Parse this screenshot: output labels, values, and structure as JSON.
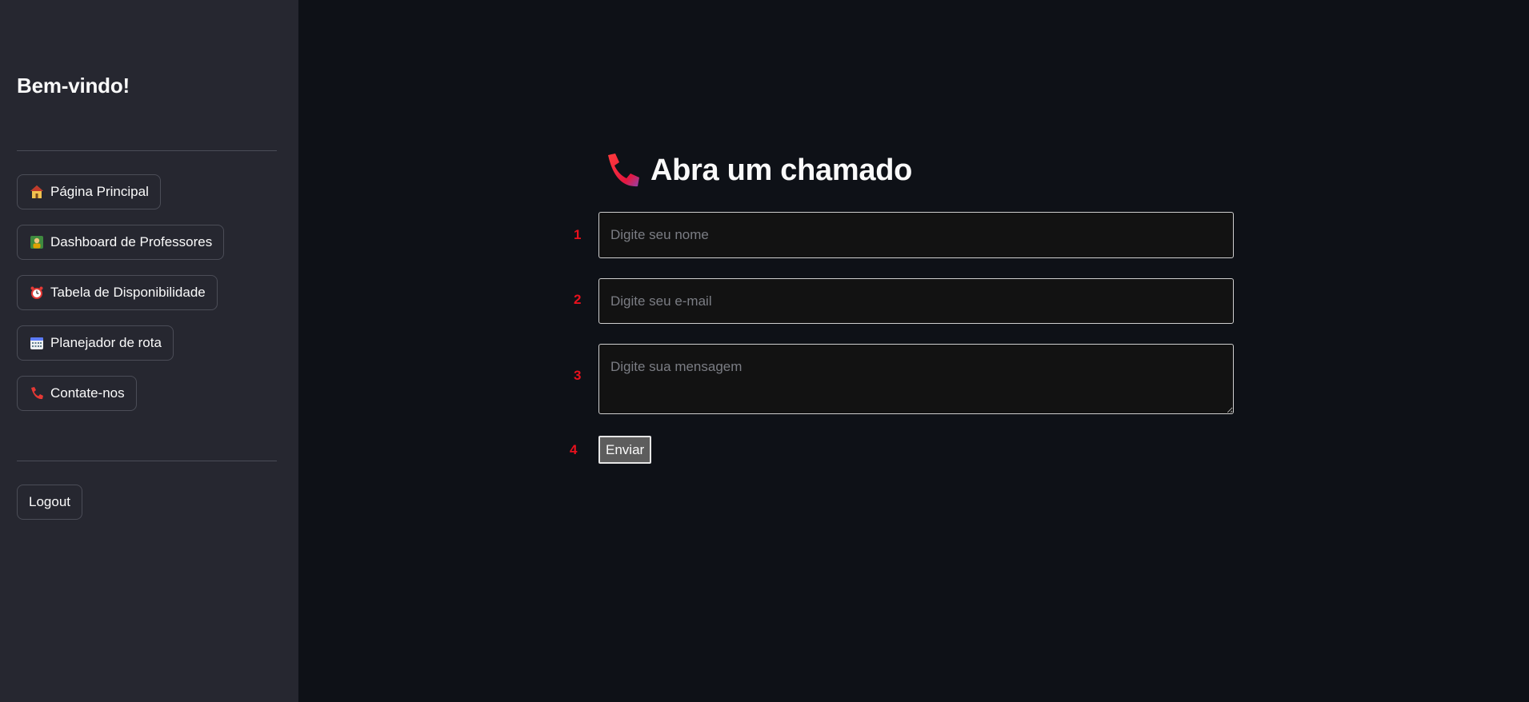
{
  "sidebar": {
    "welcome": "Bem-vindo!",
    "nav": [
      {
        "label": "Página Principal",
        "icon": "house-icon"
      },
      {
        "label": "Dashboard de Professores",
        "icon": "teacher-icon"
      },
      {
        "label": "Tabela de Disponibilidade",
        "icon": "alarm-clock-icon"
      },
      {
        "label": "Planejador de rota",
        "icon": "calendar-icon"
      },
      {
        "label": "Contate-nos",
        "icon": "telephone-receiver-icon"
      }
    ],
    "logout_label": "Logout"
  },
  "main": {
    "title": "Abra um chamado",
    "title_icon": "telephone-receiver-icon",
    "steps": [
      "1",
      "2",
      "3",
      "4"
    ],
    "name_placeholder": "Digite seu nome",
    "email_placeholder": "Digite seu e-mail",
    "message_placeholder": "Digite sua mensagem",
    "submit_label": "Enviar"
  },
  "colors": {
    "sidebar_bg": "#262730",
    "main_bg": "#0e1117",
    "accent_red": "#e8111d"
  }
}
